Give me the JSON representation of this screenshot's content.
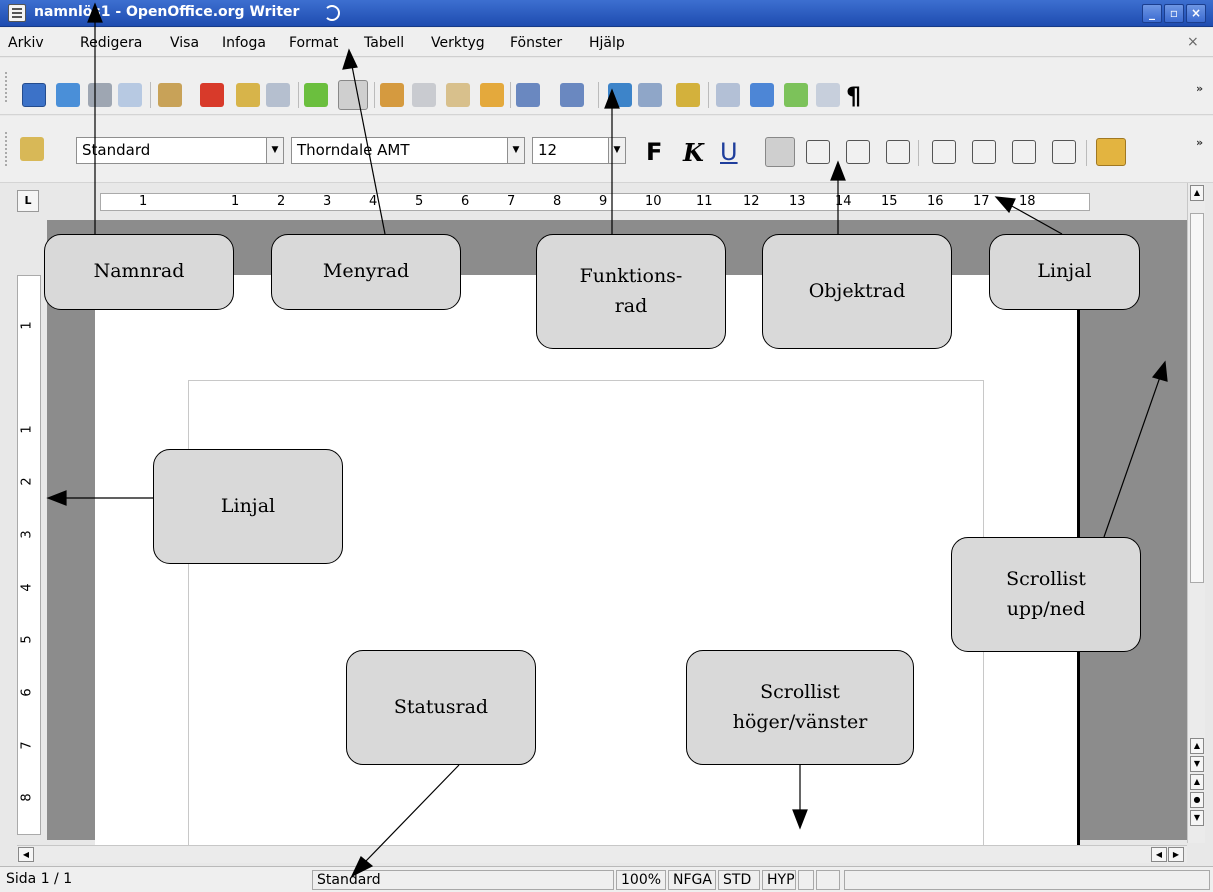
{
  "window": {
    "title": "namnlös1 - OpenOffice.org Writer",
    "min_symbol": "_",
    "max_symbol": "▫",
    "close_symbol": "×"
  },
  "menu": {
    "items": [
      "Arkiv",
      "Redigera",
      "Visa",
      "Infoga",
      "Format",
      "Tabell",
      "Verktyg",
      "Fönster",
      "Hjälp"
    ],
    "doc_close": "×"
  },
  "function_bar": {
    "icons": [
      "new-document-icon",
      "open-icon",
      "save-icon",
      "edit-file-icon",
      "export-pdf-icon",
      "print-icon",
      "page-preview-icon",
      "spellcheck-icon",
      "autospellcheck-icon",
      "cut-icon",
      "copy-icon",
      "paste-icon",
      "format-paintbrush-icon",
      "undo-icon",
      "redo-icon",
      "hyperlink-icon",
      "table-icon",
      "show-draw-functions-icon",
      "find-replace-icon",
      "navigator-icon",
      "gallery-icon",
      "data-sources-icon",
      "formatting-marks-icon"
    ],
    "pilcrow": "¶",
    "more": "»"
  },
  "object_bar": {
    "style": "Standard",
    "font": "Thorndale AMT",
    "size": "12",
    "bold": "F",
    "italic": "K",
    "underline": "U",
    "more": "»"
  },
  "ruler": {
    "corner": "L",
    "h_ticks": [
      "1",
      "1",
      "2",
      "3",
      "4",
      "5",
      "6",
      "7",
      "8",
      "9",
      "10",
      "11",
      "12",
      "13",
      "14",
      "15",
      "16",
      "17",
      "18"
    ],
    "v_ticks": [
      "1",
      "1",
      "2",
      "3",
      "4",
      "5",
      "6",
      "7",
      "8"
    ]
  },
  "callouts": {
    "namnrad": "Namnrad",
    "menyrad": "Menyrad",
    "funktionsrad": "Funktions-\nrad",
    "objektrad": "Objektrad",
    "linjal_top": "Linjal",
    "linjal_left": "Linjal",
    "scroll_vertical": "Scrollist\nupp/ned",
    "statusrad": "Statusrad",
    "scroll_horizontal": "Scrollist\nhöger/vänster"
  },
  "status": {
    "page": "Sida  1 / 1",
    "style": "Standard",
    "zoom": "100%",
    "insert_mode": "NFGA",
    "selection_mode": "STD",
    "hyperlink_mode": "HYP"
  },
  "colors": {
    "titlebar": "#2a5bc4",
    "callout_fill": "#d9d9d9",
    "doc_background": "#8c8c8c"
  }
}
